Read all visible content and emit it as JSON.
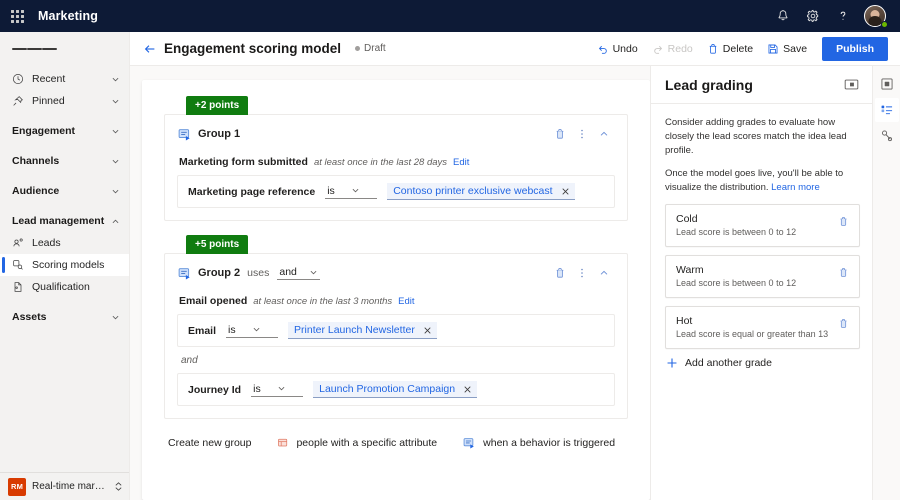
{
  "topbar": {
    "waffle_label": "app-launcher",
    "brand": "Marketing",
    "icons": [
      {
        "name": "notification-bell-icon",
        "label": "Notifications"
      },
      {
        "name": "settings-gear-icon",
        "label": "Settings"
      },
      {
        "name": "help-question-icon",
        "label": "Help"
      }
    ],
    "avatar_label": "User account"
  },
  "sidebar": {
    "hamburger_label": "Collapse site map",
    "items": [
      {
        "label": "Recent",
        "icon": "clock-icon",
        "type": "item",
        "expandable": true,
        "chevron": "down"
      },
      {
        "label": "Pinned",
        "icon": "pin-icon",
        "type": "item",
        "expandable": true,
        "chevron": "down"
      },
      {
        "label": "Engagement",
        "icon": "",
        "type": "group",
        "expandable": true,
        "chevron": "down"
      },
      {
        "label": "Channels",
        "icon": "",
        "type": "group",
        "expandable": true,
        "chevron": "down"
      },
      {
        "label": "Audience",
        "icon": "",
        "type": "group",
        "expandable": true,
        "chevron": "down"
      },
      {
        "label": "Lead management",
        "icon": "",
        "type": "group",
        "expandable": true,
        "chevron": "up"
      },
      {
        "label": "Leads",
        "icon": "leads-icon",
        "type": "sub",
        "expandable": false,
        "chevron": ""
      },
      {
        "label": "Scoring models",
        "icon": "scoring-model-icon",
        "type": "sub",
        "selected": true,
        "expandable": false,
        "chevron": ""
      },
      {
        "label": "Qualification",
        "icon": "qualification-icon",
        "type": "sub",
        "expandable": false,
        "chevron": ""
      },
      {
        "label": "Assets",
        "icon": "",
        "type": "group",
        "expandable": true,
        "chevron": "down"
      }
    ],
    "area_switcher": {
      "badge": "RM",
      "label": "Real-time marketi..."
    }
  },
  "commandbar": {
    "back_label": "Back",
    "title": "Engagement scoring model",
    "status": "Draft",
    "actions": [
      {
        "label": "Undo",
        "icon": "undo-icon",
        "disabled": false
      },
      {
        "label": "Redo",
        "icon": "redo-icon",
        "disabled": true
      },
      {
        "label": "Delete",
        "icon": "trash-icon",
        "disabled": false
      },
      {
        "label": "Save",
        "icon": "save-disk-icon",
        "disabled": false
      }
    ],
    "publish_label": "Publish"
  },
  "canvas": {
    "groups": [
      {
        "points_badge": "+2 points",
        "name": "Group 1",
        "uses_label": "",
        "logic_operator": "",
        "header_icons": [
          "trash-icon",
          "more-vertical-icon",
          "chevron-up-icon"
        ],
        "condition": {
          "name": "Marketing form submitted",
          "description": "at least once in the last 28 days",
          "edit_label": "Edit"
        },
        "rows": [
          {
            "attribute": "Marketing page reference",
            "operator": "is",
            "value": "Contoso printer exclusive webcast",
            "join_before": ""
          }
        ]
      },
      {
        "points_badge": "+5 points",
        "name": "Group 2",
        "uses_label": "uses",
        "logic_operator": "and",
        "header_icons": [
          "trash-icon",
          "more-vertical-icon",
          "chevron-up-icon"
        ],
        "condition": {
          "name": "Email opened",
          "description": "at least once in the last 3 months",
          "edit_label": "Edit"
        },
        "rows": [
          {
            "attribute": "Email",
            "operator": "is",
            "value": "Printer Launch Newsletter",
            "join_before": ""
          },
          {
            "attribute": "Journey Id",
            "operator": "is",
            "value": "Launch Promotion Campaign",
            "join_before": "and"
          }
        ]
      }
    ],
    "create_row": {
      "label": "Create new group",
      "options": [
        {
          "label": "people with a specific attribute",
          "icon": "attribute-group-icon"
        },
        {
          "label": "when a behavior is triggered",
          "icon": "behavior-group-icon"
        }
      ]
    }
  },
  "rightpanel": {
    "title": "Lead grading",
    "collapse_label": "Collapse pane",
    "paragraph1": "Consider adding grades to evaluate how closely the lead scores match the idea lead profile.",
    "paragraph2": "Once the model goes live, you'll be able to visualize the distribution.",
    "learn_more": "Learn more",
    "grades": [
      {
        "name": "Cold",
        "description": "Lead score is between 0 to 12",
        "delete_icon": "trash-icon"
      },
      {
        "name": "Warm",
        "description": "Lead score is between 0 to 12",
        "delete_icon": "trash-icon"
      },
      {
        "name": "Hot",
        "description": "Lead score is equal or greater than 13",
        "delete_icon": "trash-icon"
      }
    ],
    "add_grade_label": "Add another grade"
  },
  "rail": {
    "buttons": [
      {
        "name": "properties-panel-icon",
        "active": false
      },
      {
        "name": "lead-grading-panel-icon",
        "active": true
      },
      {
        "name": "related-panel-icon",
        "active": false
      }
    ]
  },
  "colors": {
    "brand_dark": "#0d1a36",
    "accent_blue": "#2266e3",
    "points_green": "#107c10",
    "nav_bg": "#f3f2f1",
    "canvas_bg": "#faf9f8",
    "area_badge": "#d83b01",
    "presence_green": "#6bb700"
  }
}
